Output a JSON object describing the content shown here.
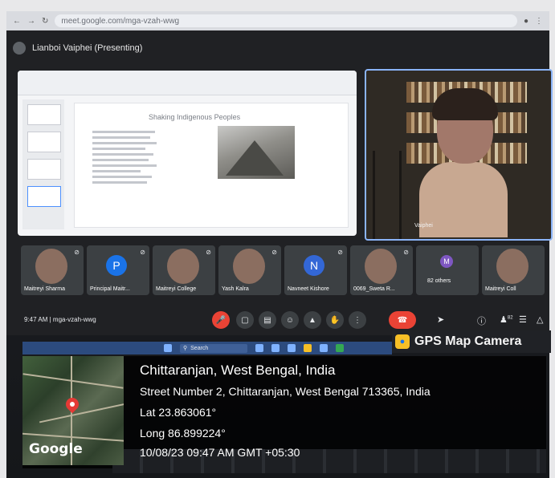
{
  "browser": {
    "url": "meet.google.com/mga-vzah-wwg"
  },
  "meet": {
    "presenter_label": "Lianboi Vaiphei (Presenting)",
    "slides": {
      "title": "Shaking Indigenous Peoples"
    },
    "speaker": {
      "name": "Vaiphei"
    },
    "participants": [
      {
        "label": "Maitreyi Sharma",
        "kind": "photo",
        "muted": true
      },
      {
        "label": "Principal Maitr...",
        "kind": "initial",
        "initial": "P",
        "color": "#1a73e8",
        "muted": true
      },
      {
        "label": "Maitreyi College",
        "kind": "photo",
        "muted": true
      },
      {
        "label": "Yash Kalra",
        "kind": "photo",
        "muted": true
      },
      {
        "label": "Navneet Kishore",
        "kind": "initial",
        "initial": "N",
        "color": "#3367d6",
        "muted": true
      },
      {
        "label": "0069_Sweta R...",
        "kind": "photo",
        "muted": true
      },
      {
        "label": "82 others",
        "kind": "others",
        "initial": "M",
        "color": "#7e57c2",
        "muted": false
      },
      {
        "label": "Maitreyi Coll",
        "kind": "photo",
        "muted": false
      }
    ],
    "bottom_bar": {
      "time": "9:47 AM",
      "separator": "|",
      "meeting_code": "mga-vzah-wwg",
      "people_badge": "82"
    }
  },
  "taskbar": {
    "search_label": "Search"
  },
  "gps": {
    "brand": "GPS Map Camera",
    "place": "Chittaranjan, West Bengal, India",
    "address": "Street Number 2, Chittaranjan, West Bengal 713365, India",
    "lat": "Lat 23.863061°",
    "long": "Long 86.899224°",
    "datetime": "10/08/23 09:47 AM GMT +05:30",
    "map_provider": "Google"
  },
  "colors": {
    "accent_blue": "#8ab4f8",
    "hangup_red": "#ea4335",
    "tile_bg": "#3c4043"
  },
  "icons": {
    "mic_off": "mic-off-icon",
    "camera": "camera-icon",
    "captions": "captions-icon",
    "emoji": "emoji-icon",
    "present": "present-icon",
    "hand": "raise-hand-icon",
    "more": "more-options-icon",
    "hangup": "hangup-icon",
    "info": "info-icon",
    "people": "people-icon",
    "chat": "chat-icon",
    "activities": "activities-icon"
  }
}
